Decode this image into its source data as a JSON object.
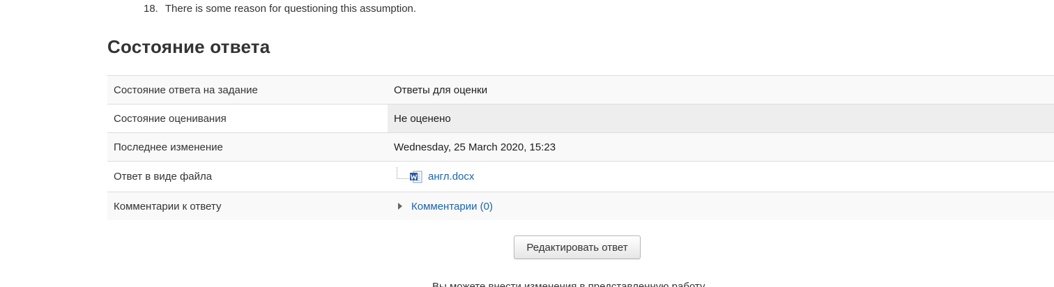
{
  "list_item": {
    "number": "18.",
    "text": "There is some reason for questioning this assumption."
  },
  "section_title": "Состояние ответа",
  "status_table": {
    "rows": [
      {
        "label": "Состояние ответа на задание",
        "value": "Ответы для оценки"
      },
      {
        "label": "Состояние оценивания",
        "value": "Не оценено"
      },
      {
        "label": "Последнее изменение",
        "value": "Wednesday, 25 March 2020, 15:23"
      },
      {
        "label": "Ответ в виде файла",
        "value": "англ.docx",
        "icon": "word-doc-icon"
      },
      {
        "label": "Комментарии к ответу",
        "value": "Комментарии (0)",
        "icon": "expand-triangle-icon"
      }
    ]
  },
  "edit_button_label": "Редактировать ответ",
  "footer_partial_text": "Вы можете внести изменения в представленную работу",
  "colors": {
    "link": "#1e64a8",
    "word_icon_blue": "#2b579a",
    "row_alt": "#f9f9f9",
    "row_highlight": "#eeeeee"
  }
}
